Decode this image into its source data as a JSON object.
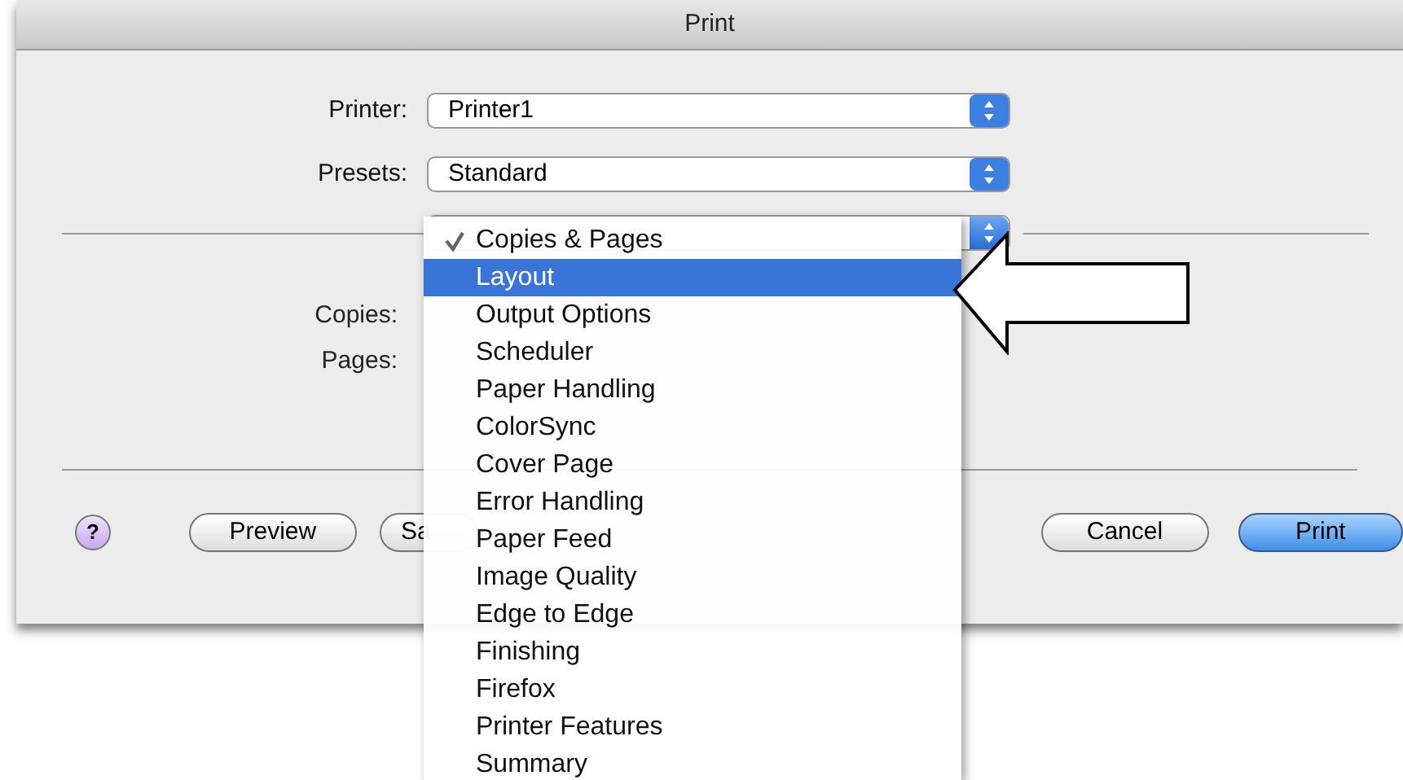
{
  "window": {
    "title": "Print"
  },
  "fields": [
    {
      "label": "Printer:",
      "value": "Printer1"
    },
    {
      "label": "Presets:",
      "value": "Standard"
    }
  ],
  "pane_labels": [
    "Copies:",
    "Pages:"
  ],
  "buttons": [
    {
      "label": "?",
      "kind": "help"
    },
    {
      "label": "Preview",
      "kind": "plain"
    },
    {
      "label": "Sa",
      "kind": "plain"
    },
    {
      "label": "Cancel",
      "kind": "plain"
    },
    {
      "label": "Print",
      "kind": "default"
    }
  ],
  "menu": [
    {
      "label": "Copies & Pages",
      "checked": true,
      "selected": false
    },
    {
      "label": "Layout",
      "checked": false,
      "selected": true
    },
    {
      "label": "Output Options",
      "checked": false,
      "selected": false
    },
    {
      "label": "Scheduler",
      "checked": false,
      "selected": false
    },
    {
      "label": "Paper Handling",
      "checked": false,
      "selected": false
    },
    {
      "label": "ColorSync",
      "checked": false,
      "selected": false
    },
    {
      "label": "Cover Page",
      "checked": false,
      "selected": false
    },
    {
      "label": "Error Handling",
      "checked": false,
      "selected": false
    },
    {
      "label": "Paper Feed",
      "checked": false,
      "selected": false
    },
    {
      "label": "Image Quality",
      "checked": false,
      "selected": false
    },
    {
      "label": "Edge to Edge",
      "checked": false,
      "selected": false
    },
    {
      "label": "Finishing",
      "checked": false,
      "selected": false
    },
    {
      "label": "Firefox",
      "checked": false,
      "selected": false
    },
    {
      "label": "Printer Features",
      "checked": false,
      "selected": false
    },
    {
      "label": "Summary",
      "checked": false,
      "selected": false
    }
  ]
}
